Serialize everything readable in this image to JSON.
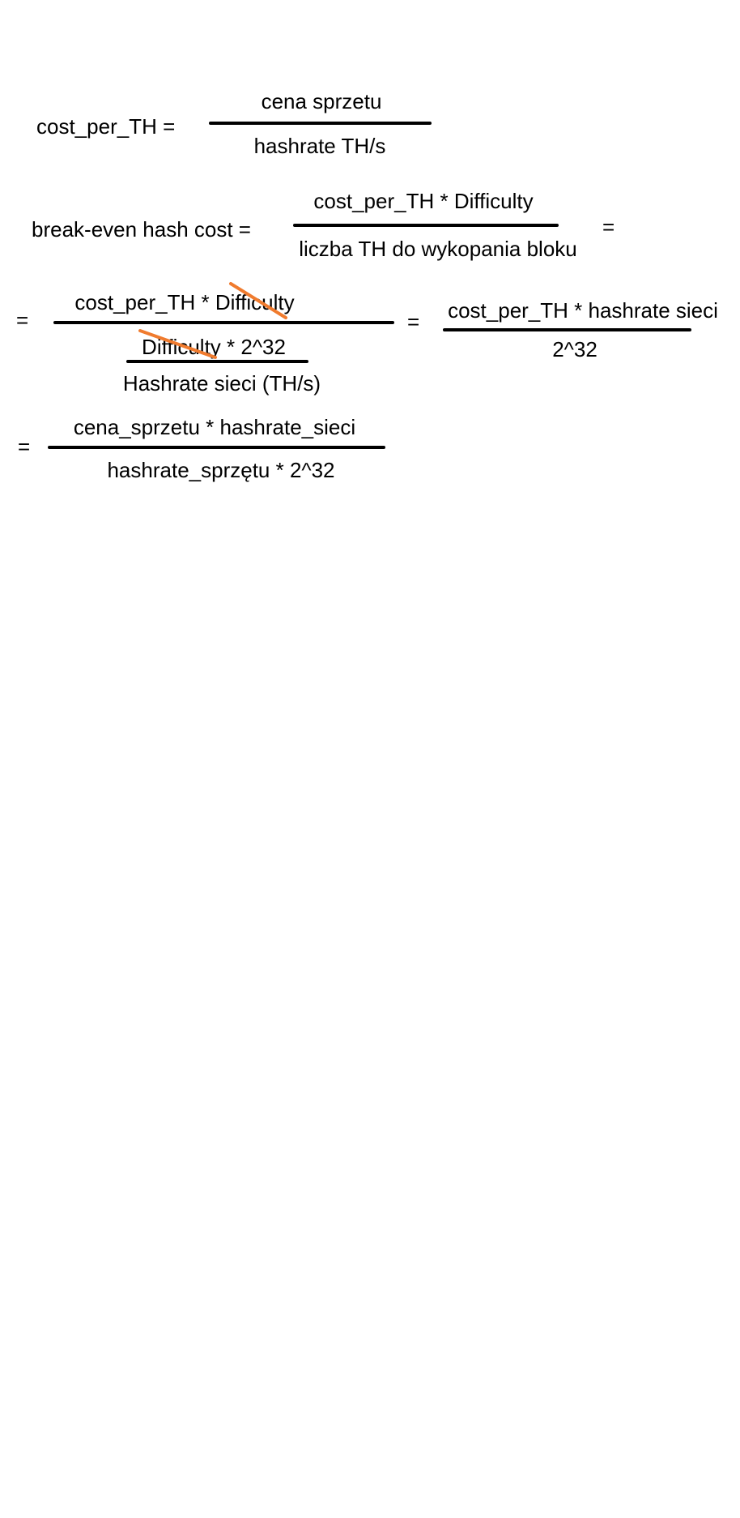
{
  "eq1": {
    "lhs": "cost_per_TH =",
    "numerator": "cena sprzetu",
    "denominator": "hashrate TH/s"
  },
  "eq2": {
    "lhs": "break-even hash cost =",
    "numerator": "cost_per_TH * Difficulty",
    "denominator": "liczba TH do wykopania bloku",
    "trailing_equals": "="
  },
  "eq3": {
    "leading_equals": "=",
    "numerator": "cost_per_TH * Difficulty",
    "inner_numerator": "Difficulty * 2^32",
    "inner_denominator": "Hashrate sieci (TH/s)",
    "middle_equals": "=",
    "result_numerator": "cost_per_TH * hashrate sieci",
    "result_denominator": "2^32"
  },
  "eq4": {
    "leading_equals": "=",
    "numerator": "cena_sprzetu * hashrate_sieci",
    "denominator": "hashrate_sprzętu * 2^32"
  },
  "colors": {
    "ink": "#000000",
    "strike": "#F07B2E",
    "background": "#ffffff"
  }
}
